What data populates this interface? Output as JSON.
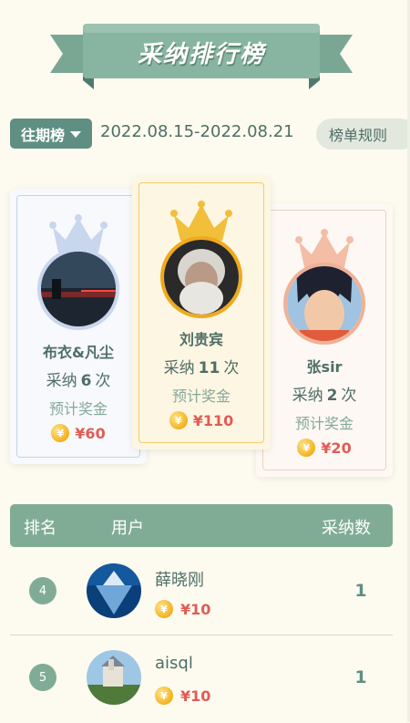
{
  "banner": {
    "title": "采纳排行榜"
  },
  "period": {
    "selector_label": "往期榜",
    "date_range": "2022.08.15-2022.08.21",
    "rules_label": "榜单规则"
  },
  "podium": {
    "first": {
      "name": "刘贵宾",
      "count_prefix": "采纳",
      "count": "11",
      "count_suffix": "次",
      "prize_label": "预计奖金",
      "prize": "¥110"
    },
    "second": {
      "name": "布衣&凡尘",
      "count_prefix": "采纳",
      "count": "6",
      "count_suffix": "次",
      "prize_label": "预计奖金",
      "prize": "¥60"
    },
    "third": {
      "name": "张sir",
      "count_prefix": "采纳",
      "count": "2",
      "count_suffix": "次",
      "prize_label": "预计奖金",
      "prize": "¥20"
    }
  },
  "coin_symbol": "¥",
  "table": {
    "headers": {
      "rank": "排名",
      "user": "用户",
      "count": "采纳数"
    },
    "rows": [
      {
        "rank": "4",
        "name": "薛晓刚",
        "prize": "¥10",
        "count": "1"
      },
      {
        "rank": "5",
        "name": "aisql",
        "prize": "¥10",
        "count": "1"
      }
    ]
  },
  "colors": {
    "accent": "#80ac96",
    "accent_dark": "#5f8f83",
    "prize": "#e25b55",
    "gold": "#f1a91c",
    "silver": "#c8d6ee",
    "bronze": "#f0b196",
    "background": "#fdfbef"
  }
}
